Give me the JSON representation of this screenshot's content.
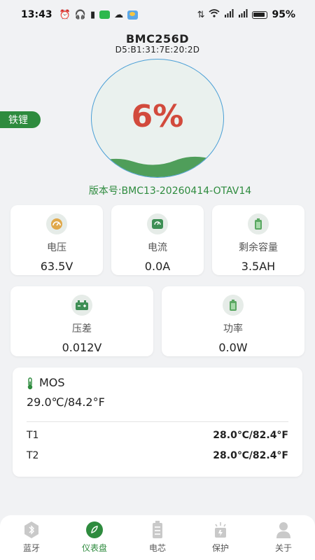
{
  "status_bar": {
    "time": "13:43",
    "battery_percent": "95%"
  },
  "device": {
    "name": "BMC256D",
    "mac": "D5:B1:31:7E:20:2D",
    "type_tag": "铁锂",
    "soc_text": "6%",
    "soc_fraction": 0.06,
    "firmware_version": "版本号:BMC13-20260414-OTAV14"
  },
  "metrics_row1": [
    {
      "label": "电压",
      "value": "63.5V",
      "icon": "gauge-icon"
    },
    {
      "label": "电流",
      "value": "0.0A",
      "icon": "ammeter-icon"
    },
    {
      "label": "剩余容量",
      "value": "3.5AH",
      "icon": "battery-capacity-icon"
    }
  ],
  "metrics_row2": [
    {
      "label": "压差",
      "value": "0.012V",
      "icon": "battery-terminal-icon"
    },
    {
      "label": "功率",
      "value": "0.0W",
      "icon": "battery-power-icon"
    }
  ],
  "temperature": {
    "mos_label": "MOS",
    "mos_value": "29.0℃/84.2°F",
    "sensors": [
      {
        "label": "T1",
        "value": "28.0℃/82.4°F"
      },
      {
        "label": "T2",
        "value": "28.0℃/82.4°F"
      }
    ]
  },
  "nav": {
    "items": [
      {
        "label": "蓝牙",
        "icon": "bluetooth-icon",
        "active": false
      },
      {
        "label": "仪表盘",
        "icon": "dashboard-icon",
        "active": true
      },
      {
        "label": "电芯",
        "icon": "battery-cell-icon",
        "active": false
      },
      {
        "label": "保护",
        "icon": "protection-icon",
        "active": false
      },
      {
        "label": "关于",
        "icon": "about-icon",
        "active": false
      }
    ]
  },
  "colors": {
    "accent_green": "#2e8b3e",
    "soc_red": "#d24a3c",
    "gauge_border": "#4a9fd6"
  }
}
